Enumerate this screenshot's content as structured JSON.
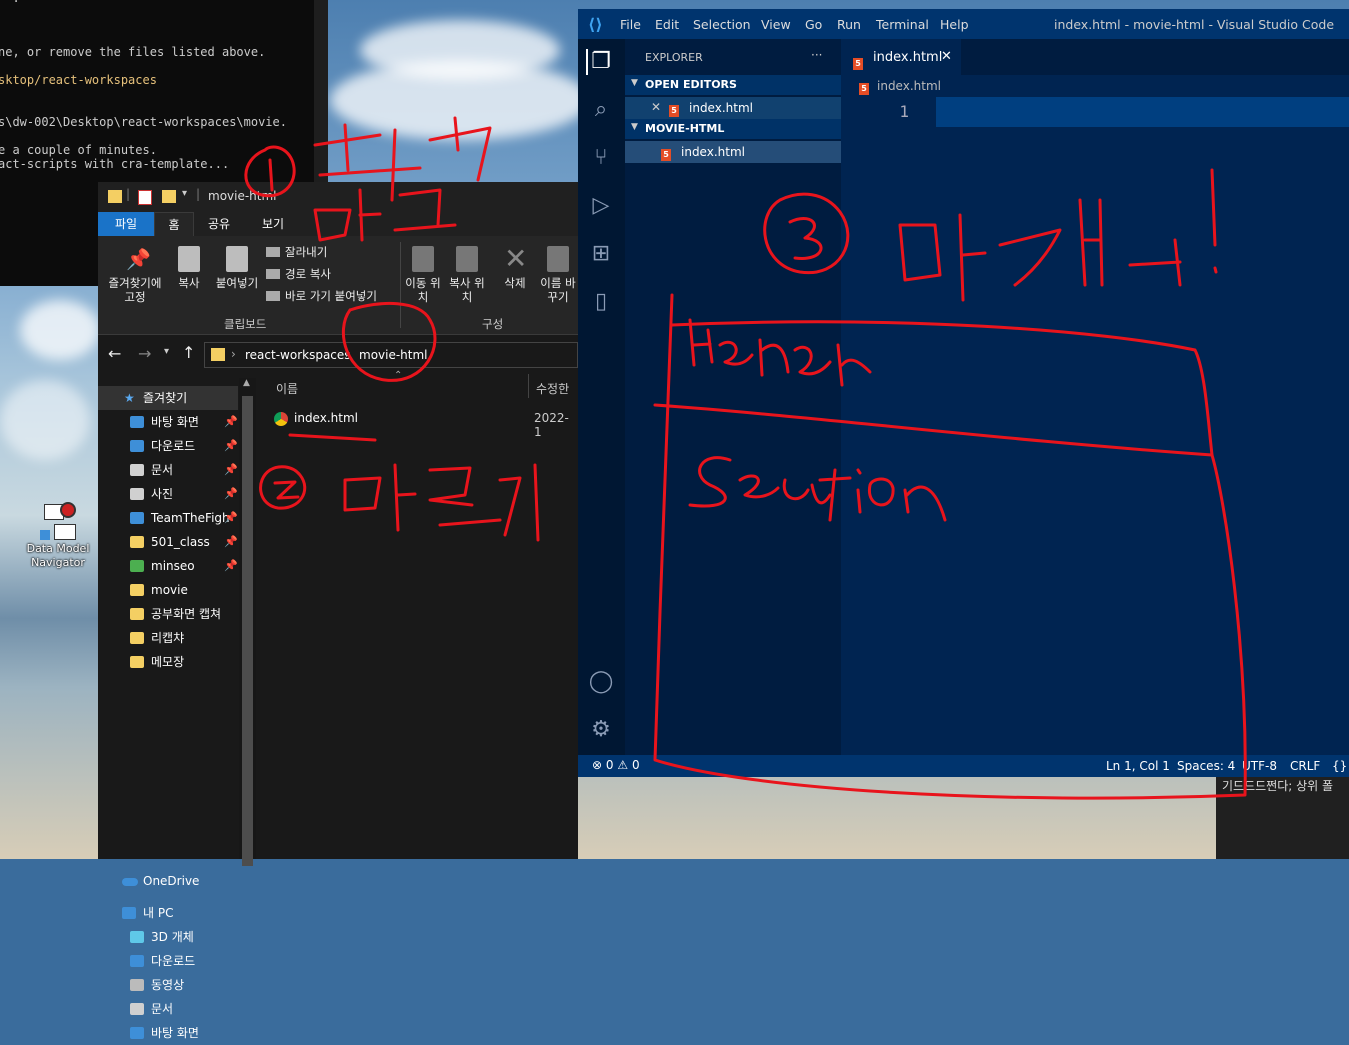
{
  "terminal": {
    "lines": [
      {
        "text": "  .",
        "style": "w"
      },
      {
        "text": "ne, or remove the files listed above.",
        "style": "w"
      },
      {
        "text": "sktop/react-workspaces",
        "style": "y"
      },
      {
        "text": "s\\dw-002\\Desktop\\react-workspaces\\movie.",
        "style": "w"
      },
      {
        "text": "e a couple of minutes.",
        "style": "w"
      },
      {
        "text": "act-scripts with cra-template...",
        "style": "w"
      }
    ]
  },
  "desktop_icon": {
    "label": "Data Model Navigator"
  },
  "explorer": {
    "title": "movie-html",
    "tabs": [
      "파일",
      "홈",
      "공유",
      "보기"
    ],
    "ribbon": {
      "pin_label": "즐겨찾기에 고정",
      "copy_label": "복사",
      "paste_label": "붙여넣기",
      "cut_label": "잘라내기",
      "copy_path_label": "경로 복사",
      "paste_shortcut_label": "바로 가기 붙여넣기",
      "clipboard_group": "클립보드",
      "move_label": "이동 위치",
      "copyto_label": "복사 위치",
      "delete_label": "삭제",
      "rename_label": "이름 바꾸기",
      "organize_group": "구성"
    },
    "breadcrumb": [
      "react-workspaces",
      "movie-html"
    ],
    "nav": {
      "favorites": "즐겨찾기",
      "items": [
        {
          "label": "바탕 화면",
          "icon": "desktop-icon",
          "pinned": true
        },
        {
          "label": "다운로드",
          "icon": "download-icon",
          "pinned": true
        },
        {
          "label": "문서",
          "icon": "document-icon",
          "pinned": true
        },
        {
          "label": "사진",
          "icon": "picture-icon",
          "pinned": true
        },
        {
          "label": "TeamTheFigh",
          "icon": "gear-icon",
          "pinned": true
        },
        {
          "label": "501_class",
          "icon": "folder-icon",
          "pinned": true
        },
        {
          "label": "minseo",
          "icon": "tree-icon",
          "pinned": true
        },
        {
          "label": "movie",
          "icon": "folder-icon",
          "pinned": false
        },
        {
          "label": "공부화면 캡쳐",
          "icon": "folder-icon",
          "pinned": false
        },
        {
          "label": "리캡챠",
          "icon": "folder-icon",
          "pinned": false
        },
        {
          "label": "메모장",
          "icon": "folder-icon",
          "pinned": false
        }
      ],
      "onedrive": "OneDrive",
      "pc": "내 PC",
      "pc_items": [
        {
          "label": "3D 개체",
          "icon": "cube-icon"
        },
        {
          "label": "다운로드",
          "icon": "download-icon"
        },
        {
          "label": "동영상",
          "icon": "video-icon"
        },
        {
          "label": "문서",
          "icon": "document-icon"
        },
        {
          "label": "바탕 화면",
          "icon": "desktop-icon"
        }
      ]
    },
    "columns": {
      "name": "이름",
      "modified": "수정한"
    },
    "files": [
      {
        "name": "index.html",
        "modified": "2022-1"
      }
    ]
  },
  "vscode": {
    "menu": [
      "File",
      "Edit",
      "Selection",
      "View",
      "Go",
      "Run",
      "Terminal",
      "Help"
    ],
    "window_title": "index.html - movie-html - Visual Studio Code",
    "explorer_title": "EXPLORER",
    "explorer_more": "···",
    "open_editors": "OPEN EDITORS",
    "open_file": "index.html",
    "folder": "MOVIE-HTML",
    "folder_file": "index.html",
    "tab_label": "index.html",
    "breadcrumb_file": "index.html",
    "line_number": "1",
    "status": {
      "errors": "0",
      "warnings": "0",
      "position": "Ln 1, Col 1",
      "spaces": "Spaces: 4",
      "encoding": "UTF-8",
      "eol": "CRLF",
      "lang": "{}"
    }
  },
  "background_text": "기드드드쩐다; 상위 폴",
  "colors": {
    "ink": "#e8141c",
    "vscode_bg": "#002451",
    "html_icon": "#e44d26"
  }
}
